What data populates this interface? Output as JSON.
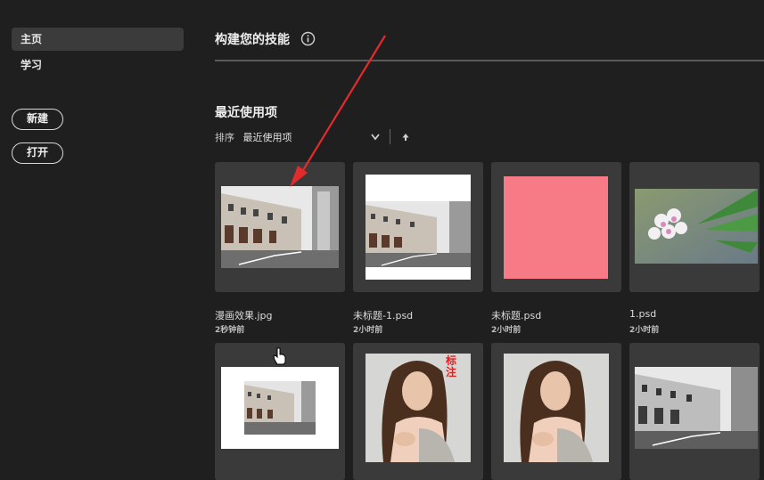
{
  "sidebar": {
    "items": [
      {
        "label": "主页",
        "active": true
      },
      {
        "label": "学习",
        "active": false
      }
    ],
    "new_label": "新建",
    "open_label": "打开"
  },
  "skills": {
    "title": "构建您的技能",
    "info_icon": "info-icon"
  },
  "recent": {
    "title": "最近使用项",
    "sort_label": "排序",
    "sort_value": "最近使用项",
    "sort_icon": "chevron-down-icon",
    "order_icon": "arrow-up-icon"
  },
  "files": [
    {
      "name": "漫画效果.jpg",
      "time": "2秒钟前",
      "thumb": "street-photo"
    },
    {
      "name": "未标题-1.psd",
      "time": "2小时前",
      "thumb": "street-photo-white-bg"
    },
    {
      "name": "未标题.psd",
      "time": "2小时前",
      "thumb": "pink-canvas"
    },
    {
      "name": "1.psd",
      "time": "2小时前",
      "thumb": "flower-photo"
    },
    {
      "thumb": "street-photo-small"
    },
    {
      "thumb": "woman-portrait-annotated",
      "annotation": "标注"
    },
    {
      "thumb": "woman-portrait"
    },
    {
      "thumb": "street-photo-bw"
    }
  ],
  "colors": {
    "background": "#1f1f1f",
    "card": "#3a3a3a",
    "pink": "#f77b87",
    "annotation_red": "#e0201e",
    "arrow_red": "#e32b2b"
  }
}
